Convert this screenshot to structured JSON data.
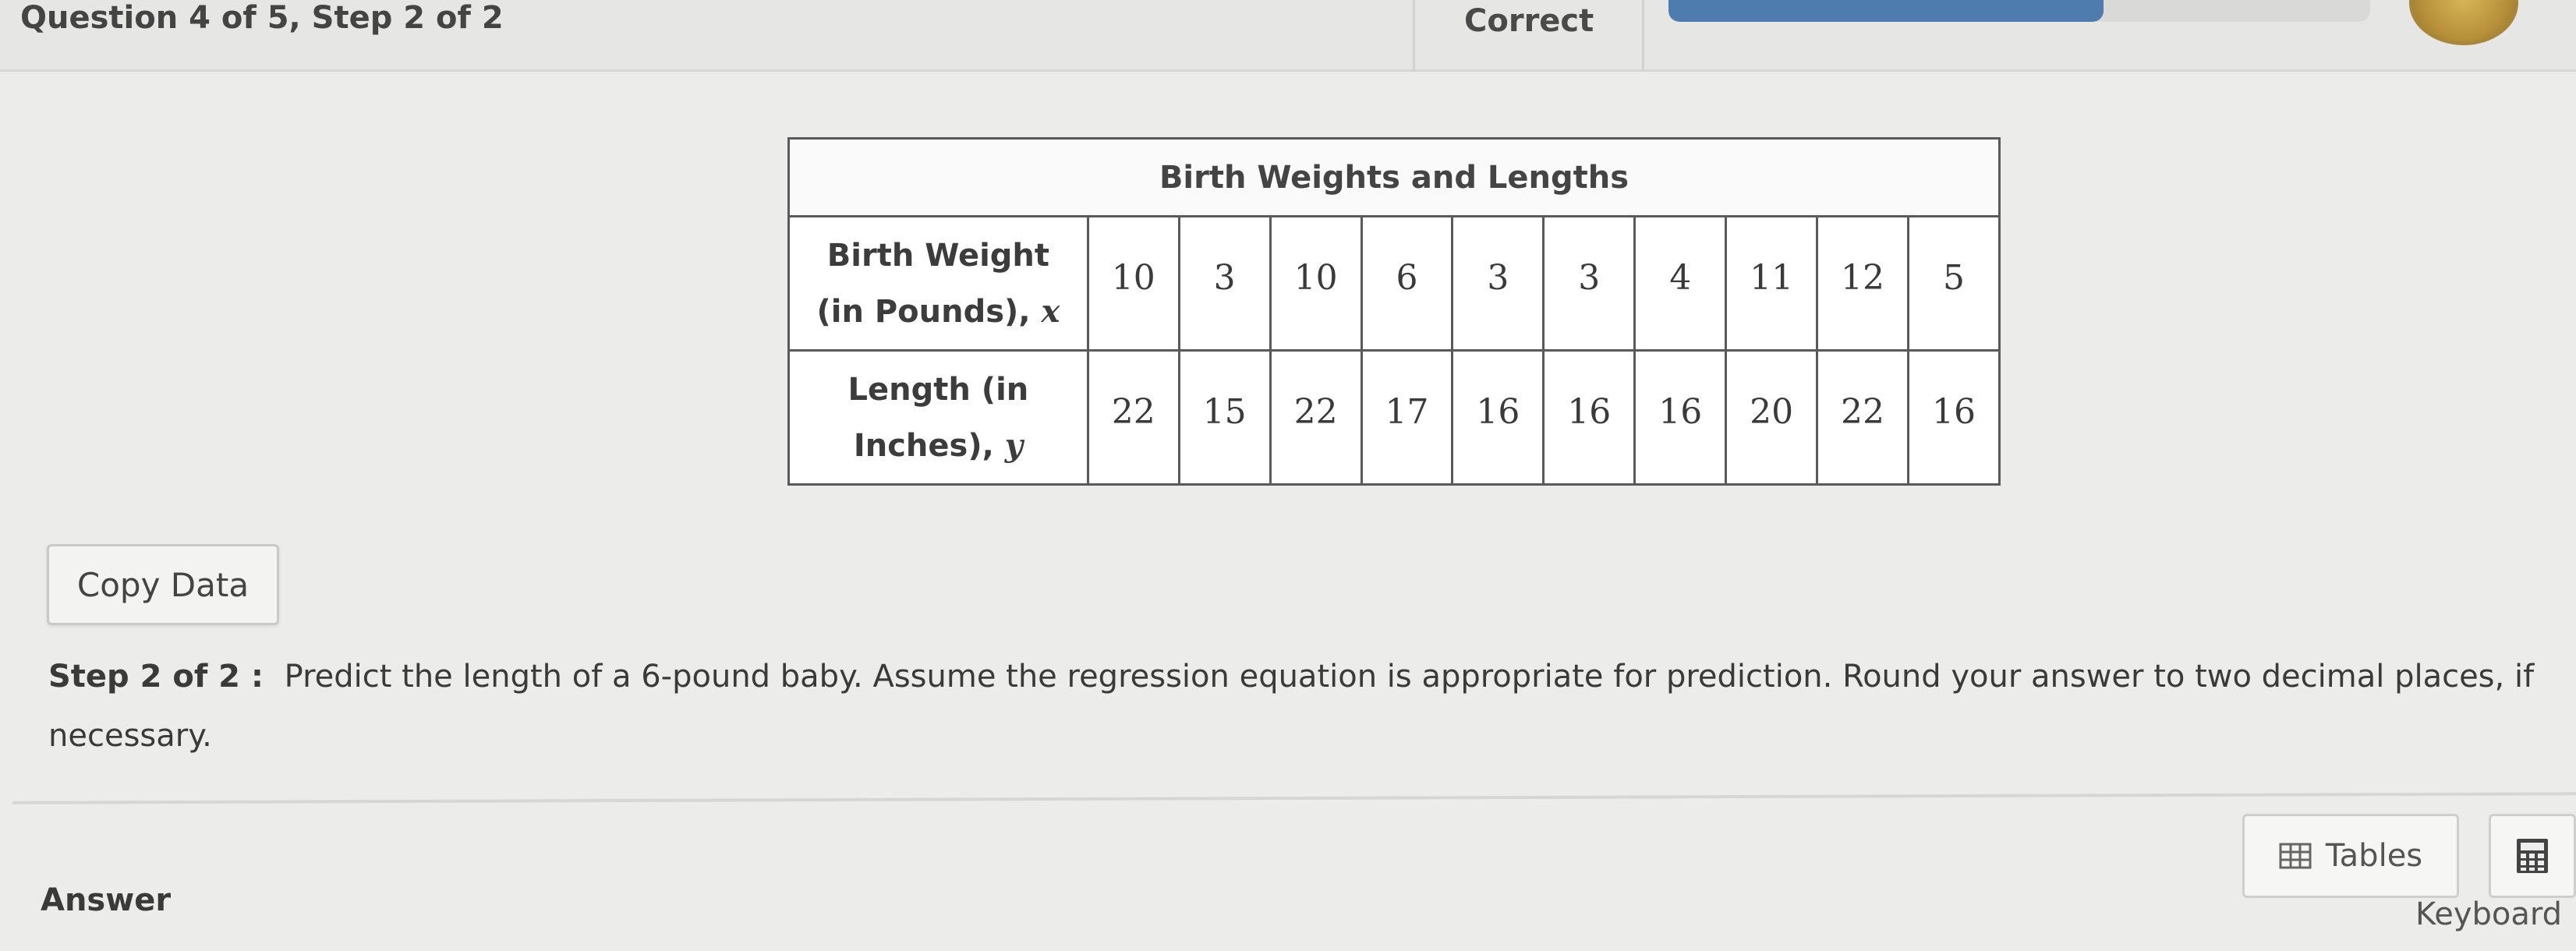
{
  "header": {
    "question_progress": "Question 4 of 5, Step 2 of 2",
    "status": "Correct",
    "progress_fraction": 0.62,
    "progress_color": "#4f7cae"
  },
  "table": {
    "caption": "Birth Weights and Lengths",
    "rows": [
      {
        "label_line1": "Birth Weight",
        "label_line2": "(in Pounds),",
        "variable": "x",
        "values": [
          "10",
          "3",
          "10",
          "6",
          "3",
          "3",
          "4",
          "11",
          "12",
          "5"
        ]
      },
      {
        "label_line1": "Length (in",
        "label_line2": "Inches),",
        "variable": "y",
        "values": [
          "22",
          "15",
          "22",
          "17",
          "16",
          "16",
          "16",
          "20",
          "22",
          "16"
        ]
      }
    ]
  },
  "copy_button": {
    "label": "Copy Data"
  },
  "question": {
    "step_label": "Step 2 of 2 :",
    "text": "Predict the length of a 6-pound baby. Assume the regression equation is appropriate for prediction. Round your answer to two decimal places, if necessary."
  },
  "answer": {
    "label": "Answer",
    "tables_button": "Tables",
    "tables_icon": "table-grid-icon",
    "calculator_icon": "calculator-icon",
    "keyboard_label": "Keyboard"
  }
}
